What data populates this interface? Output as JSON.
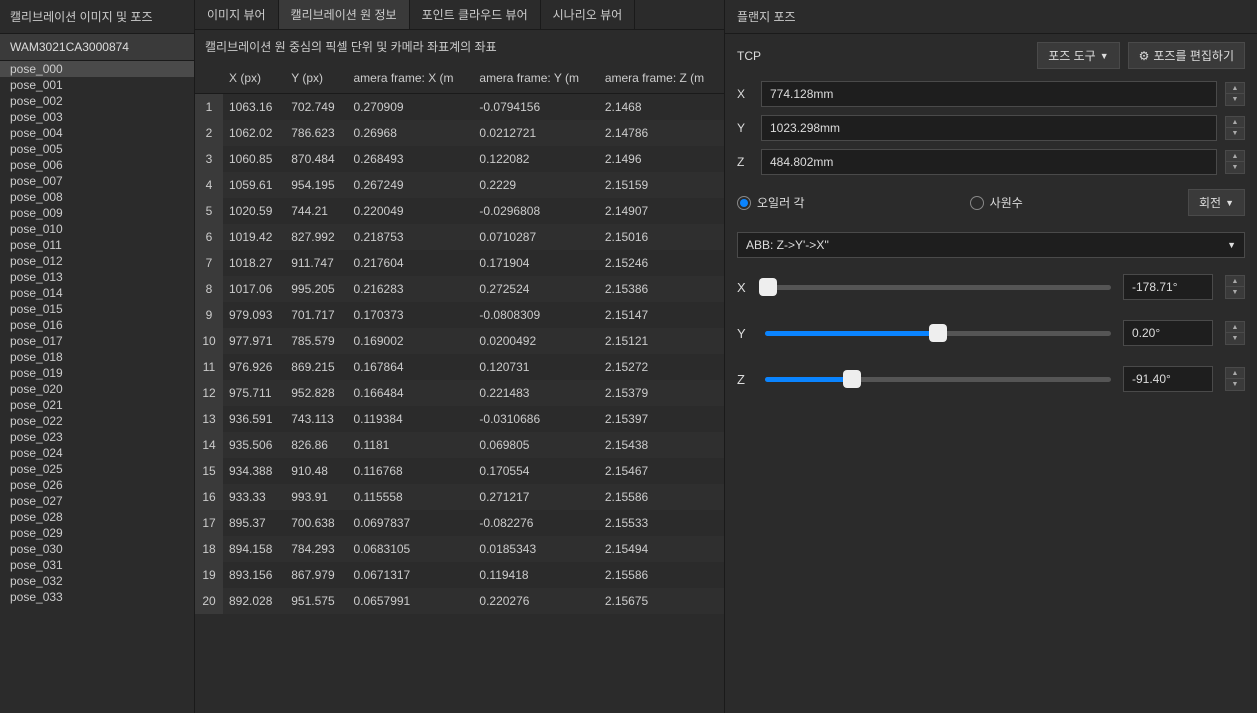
{
  "left": {
    "title": "캘리브레이션 이미지 및 포즈",
    "device": "WAM3021CA3000874",
    "poses": [
      "pose_000",
      "pose_001",
      "pose_002",
      "pose_003",
      "pose_004",
      "pose_005",
      "pose_006",
      "pose_007",
      "pose_008",
      "pose_009",
      "pose_010",
      "pose_011",
      "pose_012",
      "pose_013",
      "pose_014",
      "pose_015",
      "pose_016",
      "pose_017",
      "pose_018",
      "pose_019",
      "pose_020",
      "pose_021",
      "pose_022",
      "pose_023",
      "pose_024",
      "pose_025",
      "pose_026",
      "pose_027",
      "pose_028",
      "pose_029",
      "pose_030",
      "pose_031",
      "pose_032",
      "pose_033"
    ],
    "selected": 0
  },
  "tabs": [
    "이미지 뷰어",
    "캘리브레이션 원 정보",
    "포인트 클라우드 뷰어",
    "시나리오 뷰어"
  ],
  "active_tab": 1,
  "subtitle": "캘리브레이션 원 중심의 픽셀 단위 및 카메라 좌표계의 좌표",
  "table": {
    "headers": [
      "",
      "X (px)",
      "Y (px)",
      "amera frame: X (m",
      "amera frame: Y (m",
      "amera frame: Z (m"
    ],
    "rows": [
      [
        "1",
        "1063.16",
        "702.749",
        "0.270909",
        "-0.0794156",
        "2.1468"
      ],
      [
        "2",
        "1062.02",
        "786.623",
        "0.26968",
        "0.0212721",
        "2.14786"
      ],
      [
        "3",
        "1060.85",
        "870.484",
        "0.268493",
        "0.122082",
        "2.1496"
      ],
      [
        "4",
        "1059.61",
        "954.195",
        "0.267249",
        "0.2229",
        "2.15159"
      ],
      [
        "5",
        "1020.59",
        "744.21",
        "0.220049",
        "-0.0296808",
        "2.14907"
      ],
      [
        "6",
        "1019.42",
        "827.992",
        "0.218753",
        "0.0710287",
        "2.15016"
      ],
      [
        "7",
        "1018.27",
        "911.747",
        "0.217604",
        "0.171904",
        "2.15246"
      ],
      [
        "8",
        "1017.06",
        "995.205",
        "0.216283",
        "0.272524",
        "2.15386"
      ],
      [
        "9",
        "979.093",
        "701.717",
        "0.170373",
        "-0.0808309",
        "2.15147"
      ],
      [
        "10",
        "977.971",
        "785.579",
        "0.169002",
        "0.0200492",
        "2.15121"
      ],
      [
        "11",
        "976.926",
        "869.215",
        "0.167864",
        "0.120731",
        "2.15272"
      ],
      [
        "12",
        "975.711",
        "952.828",
        "0.166484",
        "0.221483",
        "2.15379"
      ],
      [
        "13",
        "936.591",
        "743.113",
        "0.119384",
        "-0.0310686",
        "2.15397"
      ],
      [
        "14",
        "935.506",
        "826.86",
        "0.1181",
        "0.069805",
        "2.15438"
      ],
      [
        "15",
        "934.388",
        "910.48",
        "0.116768",
        "0.170554",
        "2.15467"
      ],
      [
        "16",
        "933.33",
        "993.91",
        "0.115558",
        "0.271217",
        "2.15586"
      ],
      [
        "17",
        "895.37",
        "700.638",
        "0.0697837",
        "-0.082276",
        "2.15533"
      ],
      [
        "18",
        "894.158",
        "784.293",
        "0.0683105",
        "0.0185343",
        "2.15494"
      ],
      [
        "19",
        "893.156",
        "867.979",
        "0.0671317",
        "0.119418",
        "2.15586"
      ],
      [
        "20",
        "892.028",
        "951.575",
        "0.0657991",
        "0.220276",
        "2.15675"
      ]
    ]
  },
  "right": {
    "title": "플랜지 포즈",
    "tcp_label": "TCP",
    "pose_tools": "포즈 도구",
    "edit_pose": "포즈를 편집하기",
    "coords": {
      "x_label": "X",
      "x_value": "774.128mm",
      "y_label": "Y",
      "y_value": "1023.298mm",
      "z_label": "Z",
      "z_value": "484.802mm"
    },
    "euler_label": "오일러 각",
    "quat_label": "사원수",
    "rotate_btn": "회전",
    "convention": "ABB: Z->Y'->X''",
    "sliders": {
      "x": {
        "label": "X",
        "value": "-178.71°",
        "pct": 1
      },
      "y": {
        "label": "Y",
        "value": "0.20°",
        "pct": 50
      },
      "z": {
        "label": "Z",
        "value": "-91.40°",
        "pct": 25
      }
    }
  }
}
